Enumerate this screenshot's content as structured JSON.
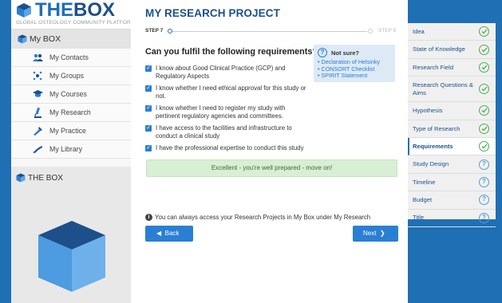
{
  "brand": {
    "logo_prefix": "THE",
    "logo_main": "BOX",
    "tagline": "GLOBAL OSTEOLOGY COMMUNITY PLATFORM",
    "primary_color": "#1f6fb4",
    "dark_color": "#1d4f8a"
  },
  "sidebar": {
    "header": "My BOX",
    "items": [
      {
        "label": "My Contacts",
        "icon": "contacts-icon"
      },
      {
        "label": "My Groups",
        "icon": "groups-icon"
      },
      {
        "label": "My Courses",
        "icon": "courses-icon"
      },
      {
        "label": "My Research",
        "icon": "research-icon"
      },
      {
        "label": "My Practice",
        "icon": "practice-icon"
      },
      {
        "label": "My Library",
        "icon": "library-icon"
      }
    ],
    "thebox_title": "THE BOX"
  },
  "main": {
    "title": "MY RESEARCH PROJECT",
    "step_current": "STEP 7",
    "step_total": "STEP 8",
    "question": "Can you fulfil the following requirements?",
    "requirements": [
      {
        "text": "I know about Good Clinical Practice (GCP) and Regulatory Aspects",
        "checked": true
      },
      {
        "text": "I know whether I need ethical approval for this study or not.",
        "checked": true
      },
      {
        "text": "I know whether I need to register my study with pertinent regulatory agencies and committees.",
        "checked": true
      },
      {
        "text": "I have access to the facilities and infrastructure to conduct a clinical study",
        "checked": true
      },
      {
        "text": "I have the professional expertise to conduct this study",
        "checked": true
      }
    ],
    "not_sure": {
      "title": "Not sure?",
      "links": [
        "Declaration of Helsinky",
        "CONSORT Checklist",
        "SPIRIT Statement"
      ]
    },
    "success_message": "Excellent - you're well prepared - move on!",
    "info_text": "You can always access your Research Projects in My Box under My Research",
    "back_label": "Back",
    "next_label": "Next"
  },
  "steps": [
    {
      "label": "Idea",
      "status": "done"
    },
    {
      "label": "State of Knowledge",
      "status": "done"
    },
    {
      "label": "Research Field",
      "status": "done"
    },
    {
      "label": "Research Questions & Aims",
      "status": "done"
    },
    {
      "label": "Hypothesis",
      "status": "done"
    },
    {
      "label": "Type of Research",
      "status": "done"
    },
    {
      "label": "Requirements",
      "status": "done",
      "active": true
    },
    {
      "label": "Study Design",
      "status": "pending"
    },
    {
      "label": "Timeline",
      "status": "pending"
    },
    {
      "label": "Budget",
      "status": "pending"
    },
    {
      "label": "Title",
      "status": "pending"
    }
  ]
}
